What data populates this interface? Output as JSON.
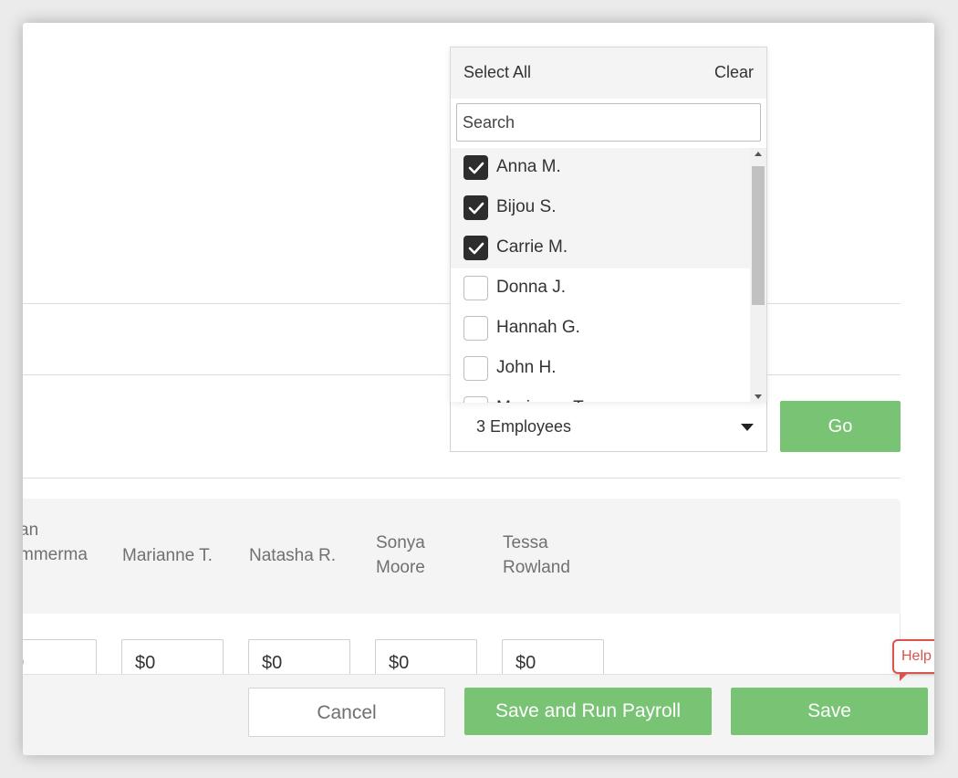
{
  "dropdown": {
    "select_all": "Select All",
    "clear": "Clear",
    "search_placeholder": "Search",
    "items": [
      {
        "label": "Anna M.",
        "checked": true
      },
      {
        "label": "Bijou S.",
        "checked": true
      },
      {
        "label": "Carrie M.",
        "checked": true
      },
      {
        "label": "Donna J.",
        "checked": false
      },
      {
        "label": "Hannah G.",
        "checked": false
      },
      {
        "label": "John H.",
        "checked": false
      },
      {
        "label": "Marianne T.",
        "checked": false
      }
    ]
  },
  "selector": {
    "value": "3 Employees",
    "go_label": "Go"
  },
  "table": {
    "columns": [
      {
        "name": "an\nmmerma",
        "amount": "0"
      },
      {
        "name": "Marianne T.",
        "amount": "$0"
      },
      {
        "name": "Natasha R.",
        "amount": "$0"
      },
      {
        "name": "Sonya\nMoore",
        "amount": "$0"
      },
      {
        "name": "Tessa\nRowland",
        "amount": "$0"
      }
    ]
  },
  "footer": {
    "cancel_label": "Cancel",
    "run_label": "Save and Run Payroll",
    "save_label": "Save"
  },
  "help": {
    "label": "Help"
  },
  "colors": {
    "accent_green": "#79c474",
    "help_red": "#d9534f"
  }
}
